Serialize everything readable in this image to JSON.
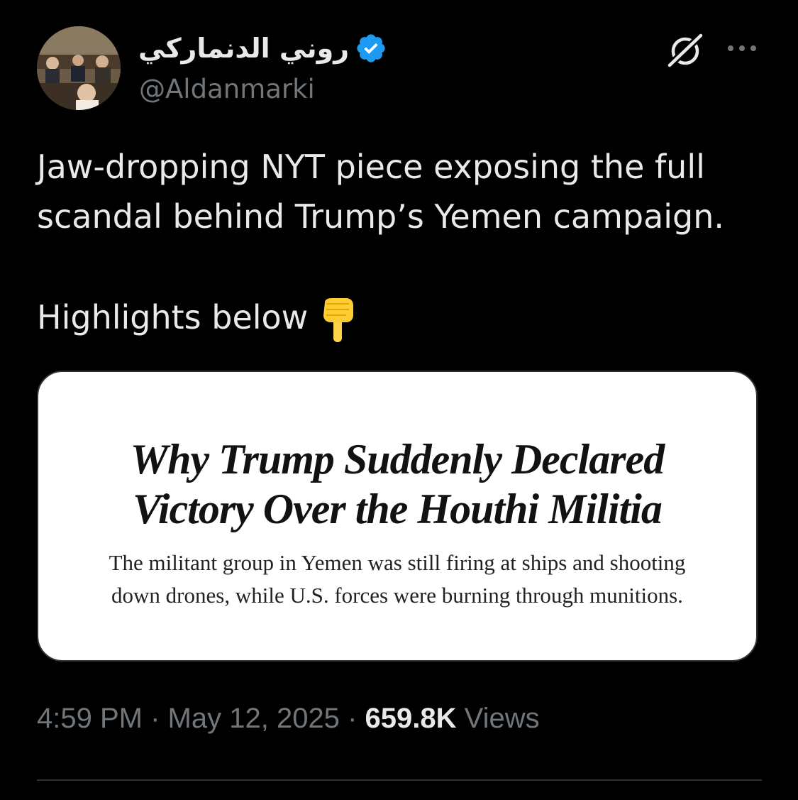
{
  "author": {
    "display_name": "روني الدنماركي",
    "handle": "@Aldanmarki",
    "verified": true,
    "verified_color": "#1d9bf0"
  },
  "header_icons": {
    "grok": "grok-icon",
    "more": "more-options-icon"
  },
  "tweet": {
    "line1": "Jaw-dropping NYT piece exposing the full",
    "line2": "scandal behind Trump’s Yemen campaign.",
    "highlights": "Highlights below",
    "emoji": "backhand-index-pointing-down"
  },
  "media": {
    "headline_line1": "Why Trump Suddenly Declared",
    "headline_line2": "Victory Over the Houthi Militia",
    "subhead_line1": "The militant group in Yemen was still firing at ships and shooting",
    "subhead_line2": "down drones, while U.S. forces were burning through munitions."
  },
  "meta": {
    "time": "4:59 PM",
    "separator": "·",
    "date": "May 12, 2025",
    "views_count": "659.8K",
    "views_label": "Views"
  },
  "colors": {
    "background": "#000000",
    "text_primary": "#e7e9ea",
    "text_secondary": "#71767b",
    "border": "#2f3336",
    "accent": "#1d9bf0"
  }
}
